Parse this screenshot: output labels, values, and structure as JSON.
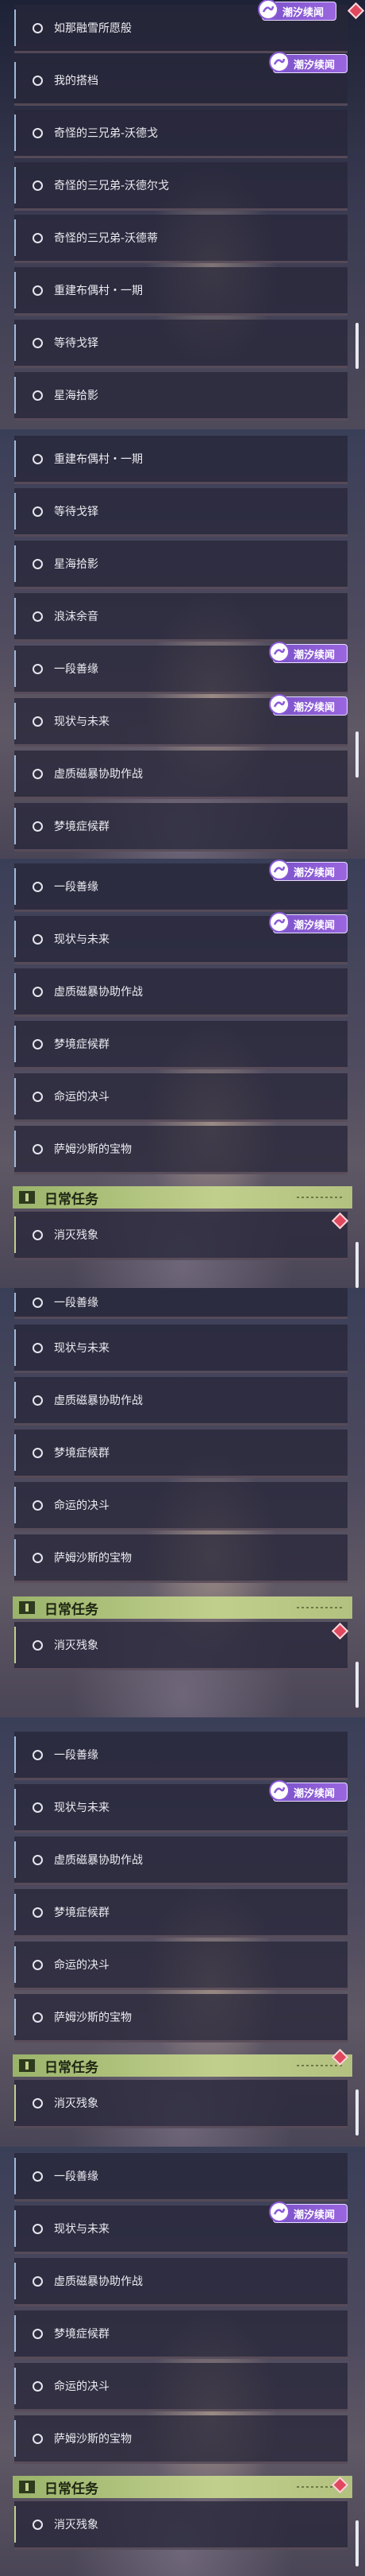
{
  "badge_text": "潮汐续闻",
  "section_title": "日常任务",
  "panel1": {
    "items": [
      "如那融雪所愿般",
      "我的搭档",
      "奇怪的三兄弟-沃德戈",
      "奇怪的三兄弟-沃德尔戈",
      "奇怪的三兄弟-沃德蒂",
      "重建布偶村・一期",
      "等待戈铎",
      "星海拾影"
    ]
  },
  "panel2": {
    "items": [
      "重建布偶村・一期",
      "等待戈铎",
      "星海拾影",
      "浪沫余音",
      "一段善缘",
      "现状与未来",
      "虚质磁暴协助作战",
      "梦境症候群"
    ]
  },
  "panel3": {
    "items": [
      "一段善缘",
      "现状与未来",
      "虚质磁暴协助作战",
      "梦境症候群",
      "命运的决斗",
      "萨姆沙斯的宝物"
    ],
    "daily": "消灭残象"
  },
  "panel4": {
    "items": [
      "一段善缘",
      "现状与未来",
      "虚质磁暴协助作战",
      "梦境症候群",
      "命运的决斗",
      "萨姆沙斯的宝物"
    ],
    "daily": "消灭残象"
  },
  "panel5": {
    "items": [
      "一段善缘",
      "现状与未来",
      "虚质磁暴协助作战",
      "梦境症候群",
      "命运的决斗",
      "萨姆沙斯的宝物"
    ],
    "daily": "消灭残象"
  },
  "panel6": {
    "items": [
      "一段善缘",
      "现状与未来",
      "虚质磁暴协助作战",
      "梦境症候群",
      "命运的决斗",
      "萨姆沙斯的宝物"
    ],
    "daily": "消灭残象"
  }
}
